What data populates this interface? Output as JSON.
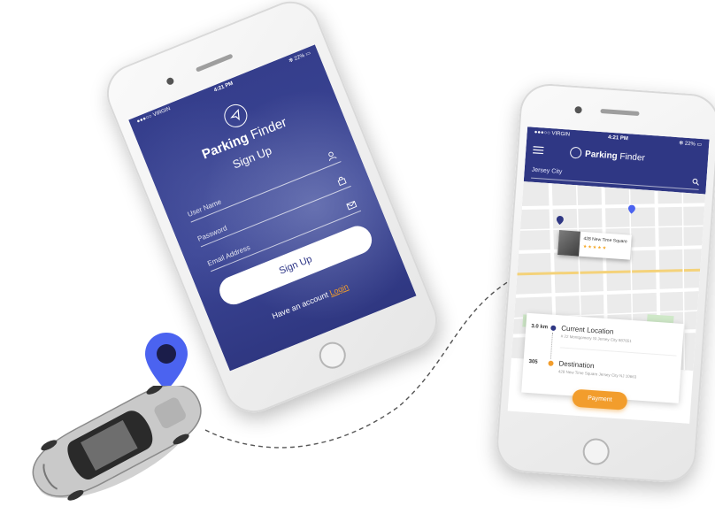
{
  "phone_signup": {
    "status": {
      "carrier": "●●●○○ VIRGIN ",
      "time": "4:21 PM",
      "battery": "✻ 22% ▭"
    },
    "brand_bold": "Parking",
    "brand_light": " Finder",
    "title": "Sign Up",
    "fields": [
      {
        "label": "User Name",
        "icon": "user-icon"
      },
      {
        "label": "Password",
        "icon": "lock-icon"
      },
      {
        "label": "Email Address",
        "icon": "mail-icon"
      }
    ],
    "signup_button": "Sign Up",
    "have_account_text": "Have an account ",
    "login_link": "Login"
  },
  "phone_map": {
    "status": {
      "carrier": "●●●○○ VIRGIN ",
      "time": "4:21 PM",
      "battery": "✻ 22% ▭"
    },
    "brand_bold": "Parking",
    "brand_light": " Finder",
    "search_value": "Jersey City",
    "place_card": {
      "name": "428 New Time Square",
      "rating": "★★★★★"
    },
    "route": {
      "current": {
        "distance": "3.0 km",
        "title": "Current Location",
        "address": "# 22 Montgomery St Jersey City 987651"
      },
      "destination": {
        "distance": "305",
        "title": "Destination",
        "address": "428 New Time Square Jersey City NJ 10663"
      }
    },
    "payment_button": "Payment"
  },
  "colors": {
    "brand": "#2f3784",
    "accent": "#f29d2c",
    "pin": "#4b63f0"
  }
}
